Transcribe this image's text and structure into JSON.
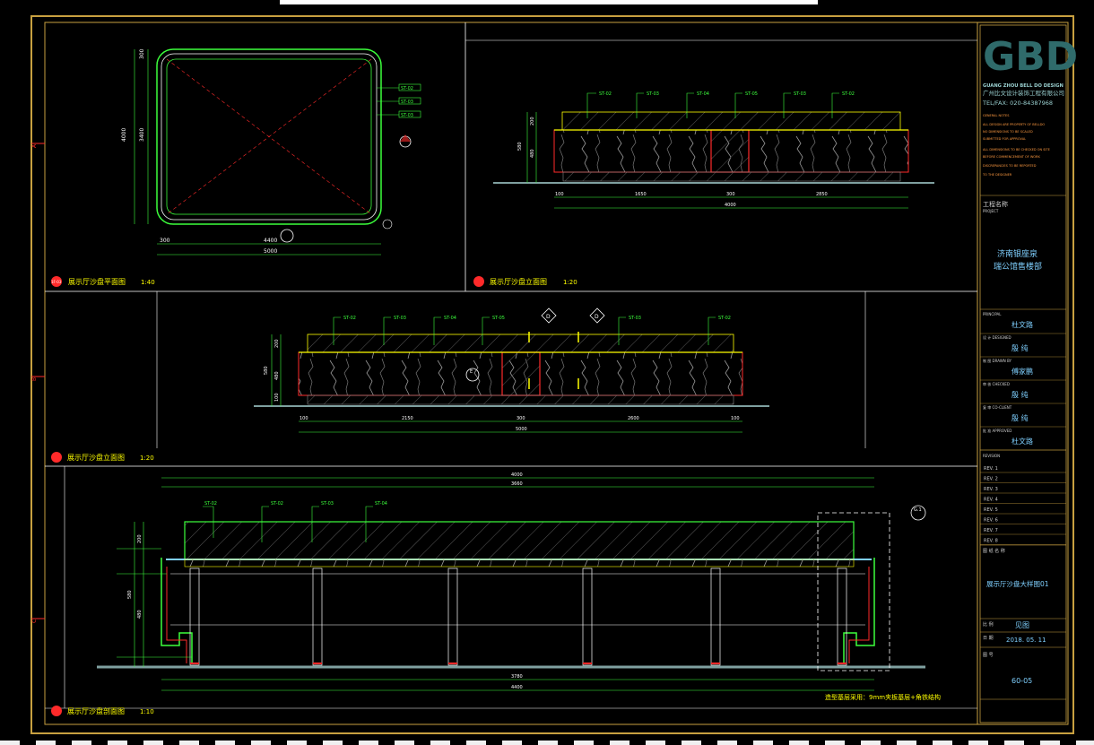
{
  "colors": {
    "frame": "#c8a040",
    "red": "#ff2a2a",
    "green": "#3cff3c",
    "yellow": "#ffff00",
    "cyan": "#7fd0ff",
    "white": "#eeeeee",
    "logo": "#2f6b6b",
    "titleblock_text": "#7fd0ff",
    "grey_hatch": "#888888"
  },
  "views": {
    "plan": {
      "title": "展示厅沙盘平面图",
      "scale": "1:40",
      "mark": "1F-03",
      "dims": {
        "total": "5000",
        "inner": "4400",
        "side": "300",
        "v_total": "4000",
        "v_inner": "3400",
        "v_side": "300"
      },
      "tags": [
        "ST-02",
        "ST-03",
        "ST-03"
      ]
    },
    "elev1": {
      "title": "展示厅沙盘立面图",
      "scale": "1:20",
      "dims": {
        "d1": "100",
        "d2": "1650",
        "d3": "300",
        "d4": "2850",
        "total": "4000",
        "h1": "200",
        "h2": "480",
        "h3": "580"
      },
      "tags": [
        "ST-02",
        "ST-03",
        "ST-04",
        "ST-05",
        "ST-03",
        "ST-02"
      ]
    },
    "elev2": {
      "title": "展示厅沙盘立面图",
      "scale": "1:20",
      "dims": {
        "d1": "100",
        "d2": "2150",
        "d3": "300",
        "d4": "2600",
        "d5": "100",
        "total": "5000",
        "h1": "200",
        "h2": "480",
        "h3": "580",
        "h4": "100"
      },
      "tags": [
        "ST-02",
        "ST-03",
        "ST-04",
        "ST-05",
        "ST-03",
        "ST-02"
      ],
      "markers": [
        "D",
        "D",
        "E"
      ]
    },
    "section": {
      "title": "展示厅沙盘剖面图",
      "scale": "1:10",
      "dims": {
        "top_total": "4000",
        "top_inner": "3660",
        "bottom_inner": "3780",
        "bottom_total": "4400",
        "h1": "200",
        "h2": "480",
        "h3": "580"
      },
      "tags": [
        "ST-02",
        "ST-02",
        "ST-03",
        "ST-04"
      ],
      "note": "造型基层采用：9mm夹板基层+角铁结构"
    }
  },
  "titleblock": {
    "logo": "GBD",
    "company_en": "GUANG ZHOU BELL DO DESIGN",
    "company_cn": "广州比文设计装饰工程有限公司",
    "tel": "TEL/FAX: 020-84387968",
    "project_label": "工程名称",
    "project_label_en": "PROJECT",
    "project_name": "济南银座泉\n瑞公馆售楼部",
    "project_line1": "济南银座泉",
    "project_line2": "瑞公馆售楼部",
    "roles": [
      {
        "label": "PRINCIPAL",
        "name": "杜文路"
      },
      {
        "label": "设 计 DESIGNED",
        "name": "殷 纯"
      },
      {
        "label": "制 图 DRAWN BY",
        "name": "傅家鹏"
      },
      {
        "label": "审 核 CHECKED",
        "name": "殷 纯"
      },
      {
        "label": "复 审 CO-CLIENT",
        "name": "殷 纯"
      },
      {
        "label": "批 准 APPROVED",
        "name": "杜文路"
      }
    ],
    "revisions_label": "REVISION",
    "revisions": [
      "REV. 1",
      "REV. 2",
      "REV. 3",
      "REV. 4",
      "REV. 5",
      "REV. 6",
      "REV. 7",
      "REV. 8"
    ],
    "drawing_label": "图 纸 名 称",
    "drawing_name": "展示厅沙盘大样图01",
    "scale_label": "比 例",
    "scale_value": "见图",
    "date_label": "日 期",
    "date_value": "2018. 05. 11",
    "no_label": "图 号",
    "no_value": "60-05"
  }
}
